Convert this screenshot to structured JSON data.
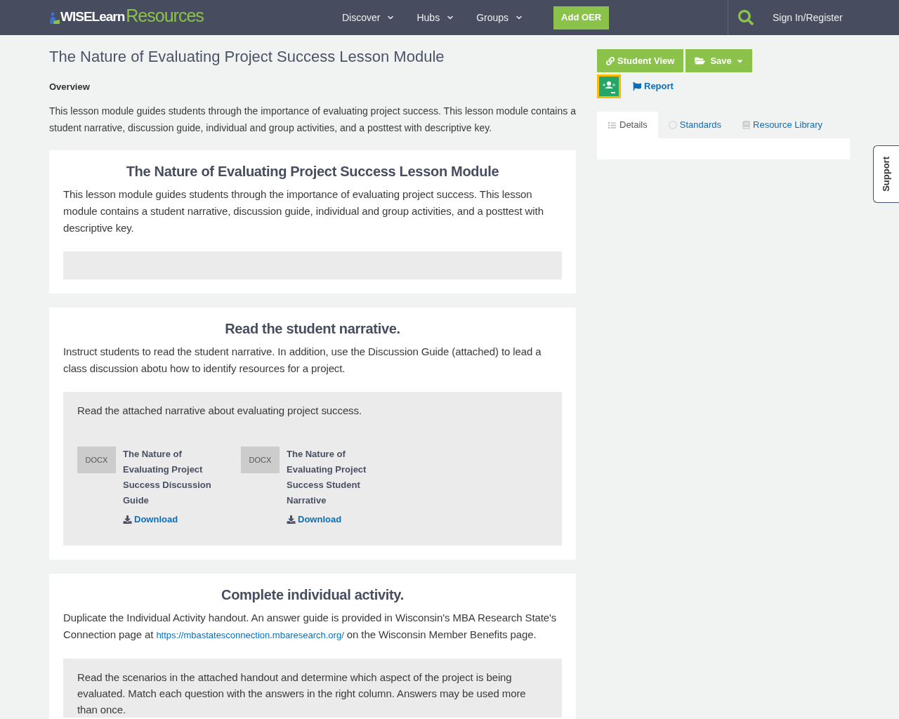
{
  "header": {
    "logo": {
      "brand": "WISELearn",
      "product": "Resources"
    },
    "nav": [
      {
        "label": "Discover"
      },
      {
        "label": "Hubs"
      },
      {
        "label": "Groups"
      }
    ],
    "add_button": "Add OER",
    "sign_in": "Sign In/Register"
  },
  "resource": {
    "title": "The Nature of Evaluating Project Success Lesson Module",
    "overview_label": "Overview",
    "overview": "This lesson module guides students through the importance of evaluating project success. This lesson module contains a student narrative, discussion guide, individual and group activities, and a posttest with descriptive key."
  },
  "sections": [
    {
      "heading": "The Nature of Evaluating Project Success Lesson Module",
      "text": [
        {
          "kind": "text",
          "text": "This lesson module guides students through the importance of evaluating project success. This lesson module contains a student narrative, discussion guide, individual and group activities, and a posttest with descriptive key."
        }
      ]
    },
    {
      "heading": "Read the student narrative.",
      "text": [
        {
          "kind": "text",
          "text": "Instruct students to read the student narrative. In addition, use the Discussion Guide (attached) to lead a class discussion abotu how to identify resources for a project."
        }
      ],
      "panel": {
        "note": "Read the attached narrative about evaluating project success.",
        "files": [
          {
            "type": "DOCX",
            "title": "The Nature of Evaluating Project Success Discussion Guide",
            "download": "Download"
          },
          {
            "type": "DOCX",
            "title": "The Nature of Evaluating Project Success Student Narrative",
            "download": "Download"
          }
        ]
      }
    },
    {
      "heading": "Complete individual activity.",
      "text": [
        {
          "kind": "text",
          "text": "Duplicate the Individual Activity handout. An answer guide is provided in Wisconsin's MBA Research State's Connection page at "
        },
        {
          "kind": "link",
          "text": "https://mbastatesconnection.mbaresearch.org/"
        },
        {
          "kind": "text",
          "text": " on the Wisconsin Member Benefits page."
        }
      ],
      "panel": {
        "note": "Read the scenarios in the attached handout and determine which aspect of the project is being evaluated. Match each question with the answers in the right column. Answers may be used more than once."
      }
    }
  ],
  "sidebar": {
    "student_view": "Student View",
    "save": "Save",
    "report": "Report",
    "tabs": [
      {
        "label": "Details",
        "selected": true
      },
      {
        "label": "Standards",
        "selected": false
      },
      {
        "label": "Resource Library",
        "selected": false
      }
    ]
  },
  "support_tab": "Support"
}
